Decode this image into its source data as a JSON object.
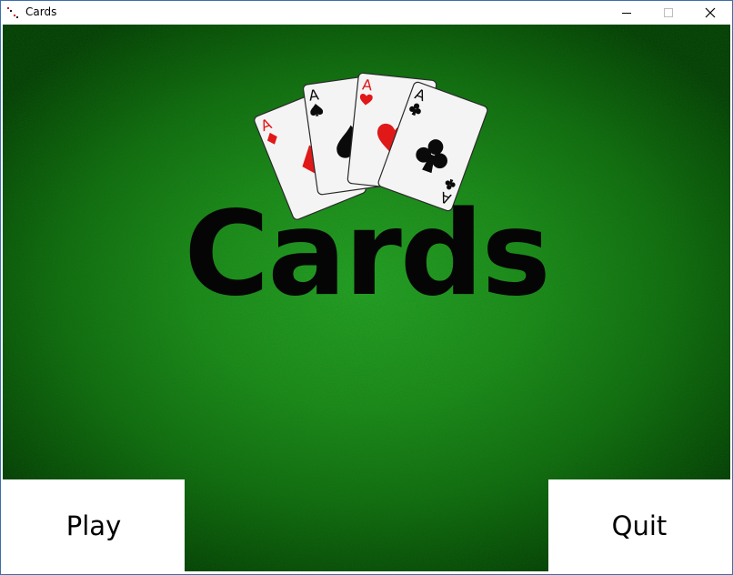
{
  "window": {
    "title": "Cards",
    "minimize_icon": "minimize-icon",
    "maximize_icon": "maximize-icon",
    "close_icon": "close-icon"
  },
  "game": {
    "logo_title": "Cards",
    "cards": [
      {
        "rank": "A",
        "suit": "diamond",
        "color": "#e01818"
      },
      {
        "rank": "A",
        "suit": "spade",
        "color": "#0a0a0a"
      },
      {
        "rank": "A",
        "suit": "heart",
        "color": "#e01818"
      },
      {
        "rank": "A",
        "suit": "club",
        "color": "#0a0a0a"
      }
    ],
    "play_label": "Play",
    "quit_label": "Quit"
  },
  "colors": {
    "felt_center": "#2aa02a",
    "felt_edge": "#0a3a0a",
    "button_bg": "#ffffff",
    "title_text": "#050505"
  }
}
